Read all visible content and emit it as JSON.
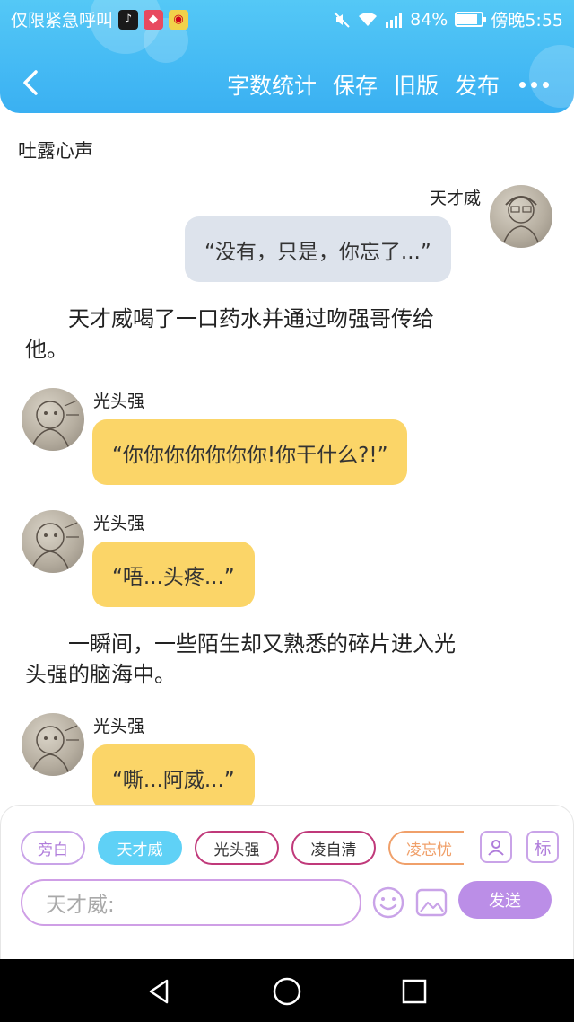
{
  "status_bar": {
    "left_text": "仅限紧急呼叫",
    "battery": "84%",
    "battery_level": 0.84,
    "time": "傍晚5:55"
  },
  "navbar": {
    "word_count": "字数统计",
    "save": "保存",
    "old_version": "旧版",
    "publish": "发布"
  },
  "story": {
    "title": "吐露心声",
    "entries": [
      {
        "speaker": "天才威",
        "text": "“没有，只是，你忘了...”"
      },
      {
        "narration": "天才威喝了一口药水并通过吻强哥传给他。"
      },
      {
        "speaker": "光头强",
        "text": "“你你你你你你你!你干什么?!”"
      },
      {
        "speaker": "光头强",
        "text": "“唔...头疼...”"
      },
      {
        "narration": "一瞬间，一些陌生却又熟悉的碎片进入光头强的脑海中。"
      },
      {
        "speaker": "光头强",
        "text": "“嘶...阿威...”"
      }
    ]
  },
  "narration_lines": {
    "n1_l1": "天才威喝了一口药水并通过吻强哥传给",
    "n1_l2": "他。",
    "n2_l1": "一瞬间，一些陌生却又熟悉的碎片进入光",
    "n2_l2": "头强的脑海中。"
  },
  "roles": [
    {
      "label": "旁白",
      "color": "#c9a3e8"
    },
    {
      "label": "天才威",
      "color": "#5fd1f6",
      "active": true
    },
    {
      "label": "光头强",
      "color": "#c0397a"
    },
    {
      "label": "凌自清",
      "color": "#c0397a"
    },
    {
      "label": "凌忘忧",
      "color": "#f0a06a"
    }
  ],
  "tools": {
    "mark_label": "标"
  },
  "input": {
    "placeholder": "天才威:"
  },
  "send_label": "发送",
  "colors": {
    "header": "#3ab0f2",
    "bubble_left": "#fbd568",
    "bubble_right": "#dde3ec",
    "accent": "#bb8ee7"
  }
}
